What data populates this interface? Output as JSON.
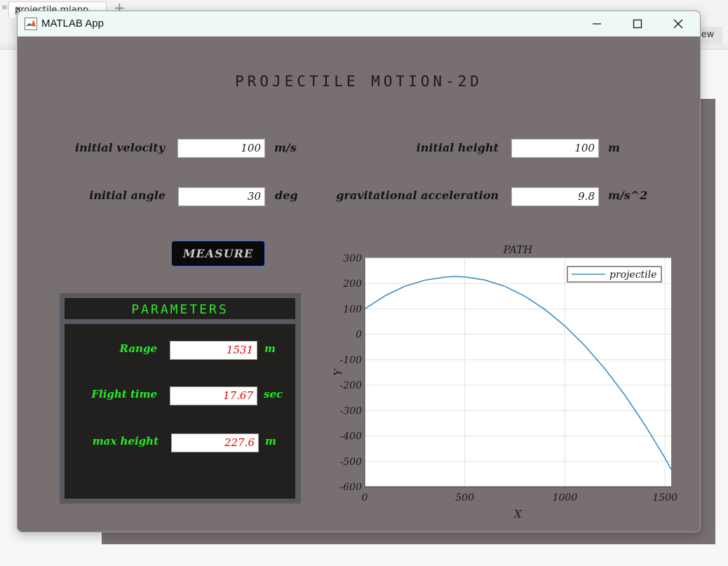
{
  "background": {
    "tab_label": "projectile.mlapp",
    "tab_close": "×",
    "tab_add": "+",
    "view_label": "iew"
  },
  "window": {
    "title": "MATLAB App",
    "minimize_glyph": "—",
    "close_glyph": "✕"
  },
  "app": {
    "title": "PROJECTILE MOTION-2D",
    "inputs": {
      "velocity": {
        "label": "initial velocity",
        "value": "100",
        "unit": "m/s"
      },
      "height": {
        "label": "initial height",
        "value": "100",
        "unit": "m"
      },
      "angle": {
        "label": "initial angle",
        "value": "30",
        "unit": "deg"
      },
      "gravity": {
        "label": "gravitational acceleration",
        "value": "9.8",
        "unit": "m/s^2"
      }
    },
    "measure_label": "MEASURE",
    "parameters": {
      "title": "PARAMETERS",
      "range": {
        "label": "Range",
        "value": "1531",
        "unit": "m"
      },
      "flight_time": {
        "label": "Flight time",
        "value": "17.67",
        "unit": "sec"
      },
      "max_height": {
        "label": "max height",
        "value": "227.6",
        "unit": "m"
      }
    }
  },
  "chart_data": {
    "type": "line",
    "title": "PATH",
    "xlabel": "X",
    "ylabel": "Y",
    "xlim": [
      0,
      1531
    ],
    "ylim": [
      -600,
      300
    ],
    "xticks": [
      0,
      500,
      1000,
      1500
    ],
    "yticks": [
      300,
      200,
      100,
      0,
      -100,
      -200,
      -300,
      -400,
      -500,
      -600
    ],
    "grid": true,
    "legend_position": "top-right",
    "series": [
      {
        "name": "projectile",
        "color": "#3b8fc4",
        "x": [
          0,
          100,
          200,
          300,
          400,
          441,
          500,
          600,
          700,
          800,
          900,
          1000,
          1100,
          1200,
          1300,
          1400,
          1500,
          1531
        ],
        "y": [
          100,
          151,
          189,
          213,
          225,
          227.6,
          226,
          214,
          189,
          150,
          98,
          33,
          -45,
          -136,
          -240,
          -357,
          -487,
          -532
        ]
      }
    ]
  }
}
